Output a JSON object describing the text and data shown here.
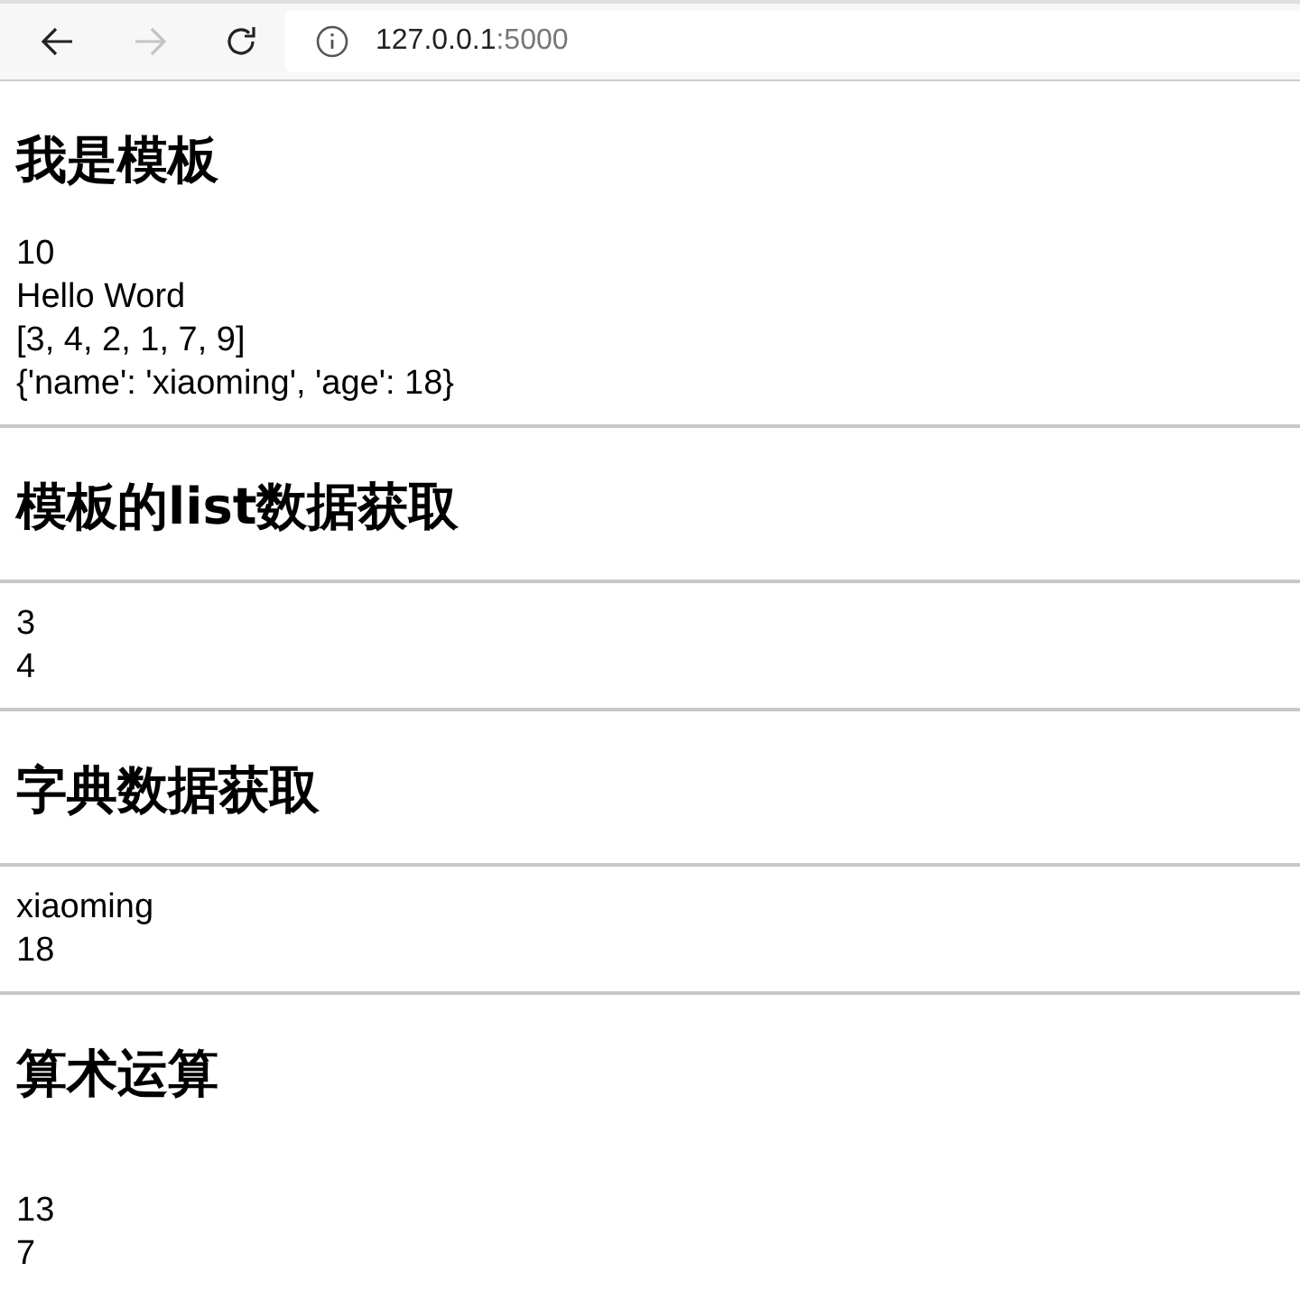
{
  "toolbar": {
    "back": {
      "disabled": false
    },
    "forward": {
      "disabled": true
    },
    "address": {
      "host": "127.0.0.1",
      "port": ":5000"
    }
  },
  "blocks": [
    {
      "kind": "heading",
      "text": "我是模板"
    },
    {
      "kind": "line",
      "text": "10"
    },
    {
      "kind": "line",
      "text": "Hello Word"
    },
    {
      "kind": "line",
      "text": "[3, 4, 2, 1, 7, 9]"
    },
    {
      "kind": "line",
      "text": "{'name': 'xiaoming', 'age': 18}"
    },
    {
      "kind": "rule"
    },
    {
      "kind": "heading",
      "text": "模板的list数据获取"
    },
    {
      "kind": "rule"
    },
    {
      "kind": "line",
      "text": "3"
    },
    {
      "kind": "line",
      "text": "4"
    },
    {
      "kind": "rule"
    },
    {
      "kind": "heading",
      "text": "字典数据获取"
    },
    {
      "kind": "rule"
    },
    {
      "kind": "line",
      "text": "xiaoming"
    },
    {
      "kind": "line",
      "text": "18"
    },
    {
      "kind": "rule"
    },
    {
      "kind": "heading",
      "text": "算术运算"
    },
    {
      "kind": "blank"
    },
    {
      "kind": "line",
      "text": "13"
    },
    {
      "kind": "line",
      "text": "7"
    }
  ]
}
